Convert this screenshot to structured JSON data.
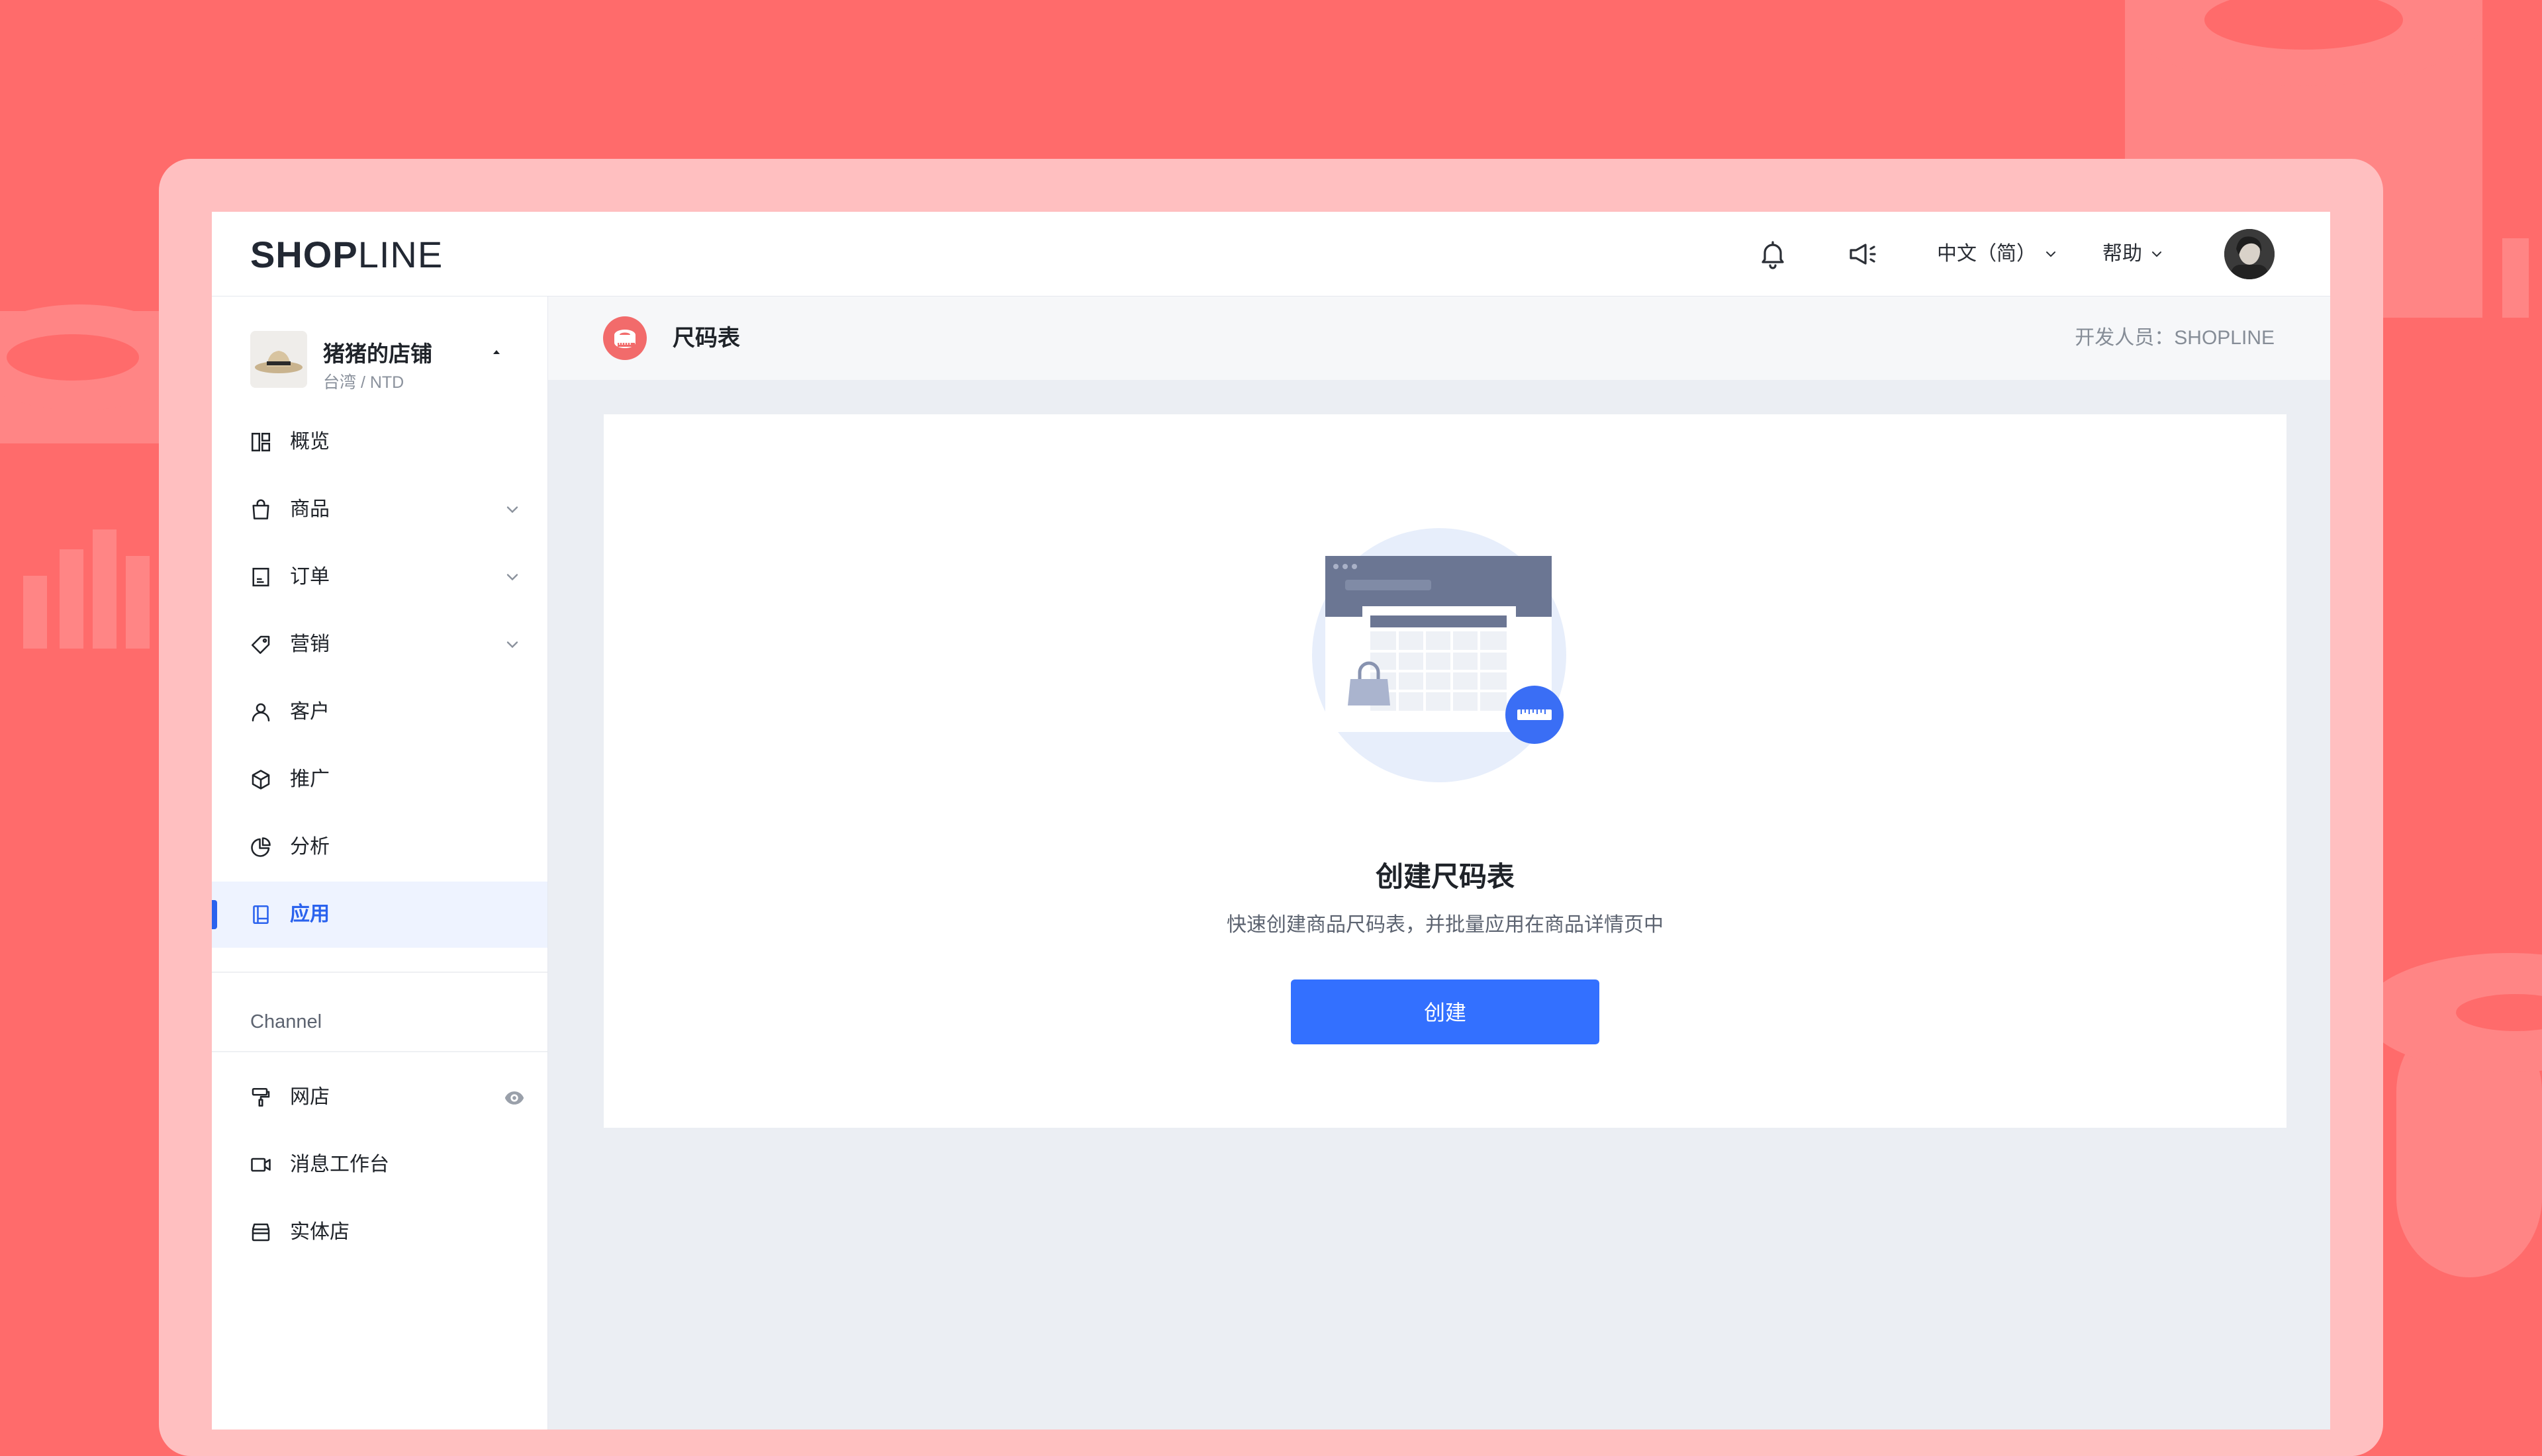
{
  "brand": {
    "logo_prefix": "SH",
    "logo_bold": "OP",
    "logo_suffix": "LINE"
  },
  "topbar": {
    "language": "中文（简）",
    "help": "帮助",
    "icons": [
      "bell-icon",
      "megaphone-icon"
    ]
  },
  "store": {
    "name": "猪猪的店铺",
    "region_currency": "台湾 / NTD"
  },
  "sidebar": {
    "items": [
      {
        "label": "概览",
        "icon": "dashboard-icon"
      },
      {
        "label": "商品",
        "icon": "bag-icon"
      },
      {
        "label": "订单",
        "icon": "order-icon"
      },
      {
        "label": "营销",
        "icon": "tag-icon"
      },
      {
        "label": "客户",
        "icon": "user-icon"
      },
      {
        "label": "推广",
        "icon": "cube-icon"
      },
      {
        "label": "分析",
        "icon": "pie-icon"
      },
      {
        "label": "应用",
        "icon": "app-icon",
        "active": true
      }
    ],
    "section_label": "Channel",
    "channel_items": [
      {
        "label": "网店",
        "icon": "brush-icon"
      },
      {
        "label": "消息工作台",
        "icon": "video-icon"
      },
      {
        "label": "实体店",
        "icon": "store-icon"
      }
    ]
  },
  "page": {
    "title": "尺码表",
    "developer": "开发人员：SHOPLINE"
  },
  "empty_state": {
    "title": "创建尺码表",
    "description": "快速创建商品尺码表，并批量应用在商品详情页中",
    "button": "创建"
  },
  "colors": {
    "background": "#FF6B6B",
    "frame": "#FFBFC0",
    "accent": "#3370FF",
    "active_nav": "#2A62EE"
  }
}
